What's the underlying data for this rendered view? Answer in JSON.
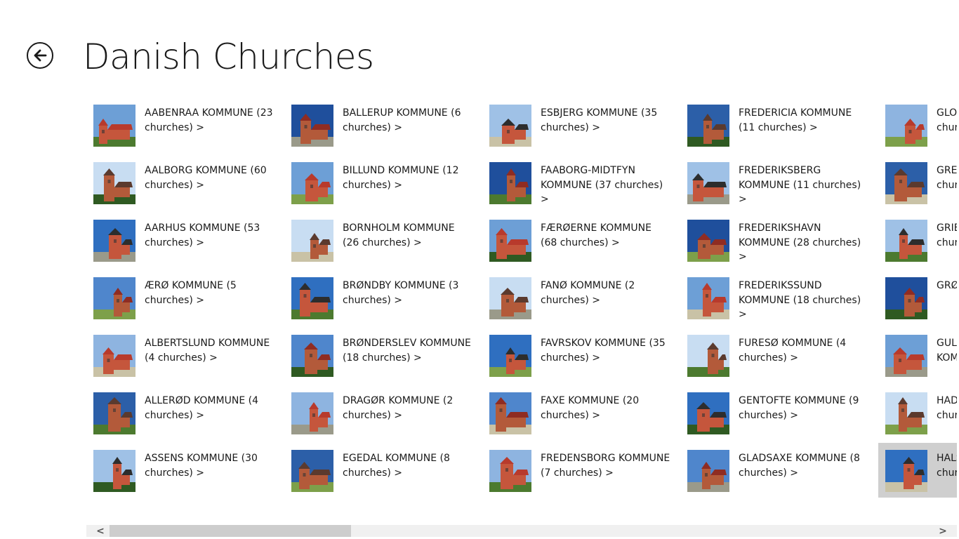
{
  "header": {
    "title": "Danish Churches"
  },
  "items": [
    {
      "label": "AABENRAA KOMMUNE (23 churches) >",
      "theme": 0
    },
    {
      "label": "AALBORG KOMMUNE (60 churches) >",
      "theme": 1
    },
    {
      "label": "AARHUS KOMMUNE (53 churches) >",
      "theme": 2
    },
    {
      "label": "ÆRØ KOMMUNE (5 churches) >",
      "theme": 3
    },
    {
      "label": "ALBERTSLUND KOMMUNE (4 churches) >",
      "theme": 4
    },
    {
      "label": "ALLERØD KOMMUNE (4 churches) >",
      "theme": 5
    },
    {
      "label": "ASSENS KOMMUNE (30 churches) >",
      "theme": 6
    },
    {
      "label": "BALLERUP KOMMUNE (6 churches) >",
      "theme": 7
    },
    {
      "label": "BILLUND KOMMUNE (12 churches) >",
      "theme": 8
    },
    {
      "label": "BORNHOLM KOMMUNE (26 churches) >",
      "theme": 9
    },
    {
      "label": "BRØNDBY KOMMUNE (3 churches) >",
      "theme": 10
    },
    {
      "label": "BRØNDERSLEV KOMMUNE (18 churches) >",
      "theme": 11
    },
    {
      "label": "DRAGØR KOMMUNE (2 churches) >",
      "theme": 12
    },
    {
      "label": "EGEDAL KOMMUNE (8 churches) >",
      "theme": 13
    },
    {
      "label": "ESBJERG KOMMUNE (35 churches) >",
      "theme": 14
    },
    {
      "label": "FAABORG-MIDTFYN KOMMUNE (37 churches) >",
      "theme": 15
    },
    {
      "label": "FÆRØERNE KOMMUNE (68 churches) >",
      "theme": 16
    },
    {
      "label": "FANØ KOMMUNE (2 churches) >",
      "theme": 17
    },
    {
      "label": "FAVRSKOV KOMMUNE (35 churches) >",
      "theme": 18
    },
    {
      "label": "FAXE KOMMUNE (20 churches) >",
      "theme": 19
    },
    {
      "label": "FREDENSBORG KOMMUNE (7 churches) >",
      "theme": 20
    },
    {
      "label": "FREDERICIA KOMMUNE (11 churches) >",
      "theme": 21
    },
    {
      "label": "FREDERIKSBERG KOMMUNE (11 churches) >",
      "theme": 22
    },
    {
      "label": "FREDERIKSHAVN KOMMUNE (28 churches) >",
      "theme": 23
    },
    {
      "label": "FREDERIKSSUND KOMMUNE (18 churches) >",
      "theme": 24
    },
    {
      "label": "FURESØ KOMMUNE (4 churches) >",
      "theme": 25
    },
    {
      "label": "GENTOFTE KOMMUNE (9 churches) >",
      "theme": 26
    },
    {
      "label": "GLADSAXE KOMMUNE (8 churches) >",
      "theme": 27
    },
    {
      "label": "GLO",
      "sub": "chur",
      "theme": 28
    },
    {
      "label": "GREV",
      "sub": "chur",
      "theme": 29
    },
    {
      "label": "GRIB",
      "sub": "chur",
      "theme": 30
    },
    {
      "label": "GRØ",
      "sub": "",
      "theme": 31
    },
    {
      "label": "GULI",
      "sub": "KOM",
      "theme": 32
    },
    {
      "label": "HAD",
      "sub": "chur",
      "theme": 33
    },
    {
      "label": "HALS",
      "sub": "chur",
      "theme": 34,
      "selected": true
    }
  ],
  "colors": {
    "sky": [
      "#6d9fd6",
      "#c8ddf2",
      "#2f6fc0",
      "#4f86cc",
      "#8eb4e0",
      "#2c5fa8",
      "#9fc1e6",
      "#1f4f9c"
    ],
    "wall": [
      "#f5f5f2",
      "#c5563c",
      "#e8e0c8",
      "#1c3b66",
      "#b35a3a",
      "#d8d2c4"
    ],
    "roof": [
      "#b83a2c",
      "#5b3a2e",
      "#2d2d2d",
      "#8f2c22"
    ],
    "ground": [
      "#4c7a2f",
      "#7da04a",
      "#2f5a22",
      "#c9c2a6",
      "#9a9a8a"
    ]
  },
  "scrollbar": {
    "left_arrow": "<",
    "right_arrow": ">"
  }
}
